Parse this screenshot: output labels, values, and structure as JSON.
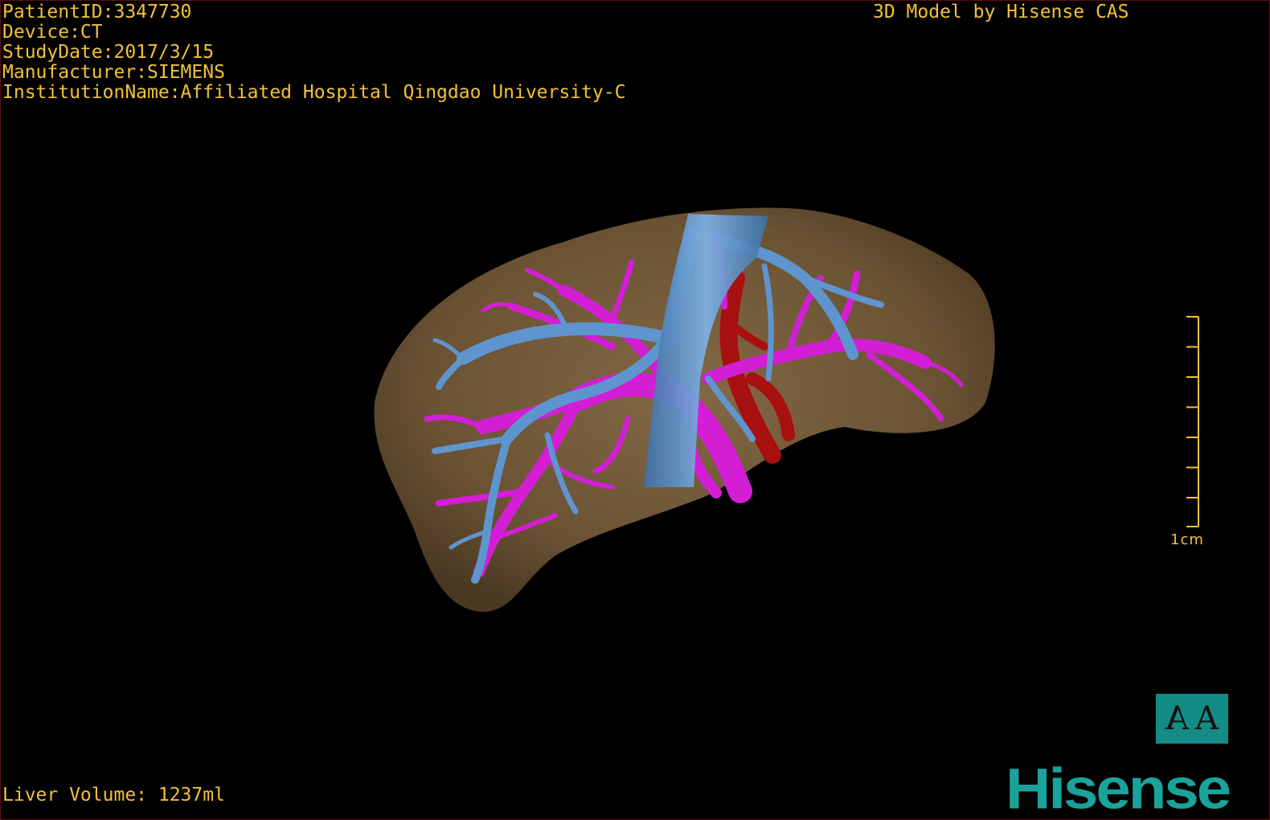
{
  "study_info": {
    "patient_id": "PatientID:3347730",
    "device": "Device:CT",
    "study_date": "StudyDate:2017/3/15",
    "manufacturer": "Manufacturer:SIEMENS",
    "institution": "InstitutionName:Affiliated Hospital Qingdao University-C"
  },
  "model_credit": "3D Model by Hisense CAS",
  "liver_volume": "Liver Volume: 1237ml",
  "scale": {
    "label": "1cm",
    "tick_count": 8
  },
  "orientation_button": {
    "left_glyph": "A",
    "right_glyph": "A"
  },
  "brand": "Hisense",
  "colors": {
    "text": "#f2c13a",
    "liver": "#7a6040",
    "hepatic_vein": "#5f95cf",
    "portal_vein": "#d31ed6",
    "artery": "#b01212",
    "brand": "#1aa39b"
  }
}
